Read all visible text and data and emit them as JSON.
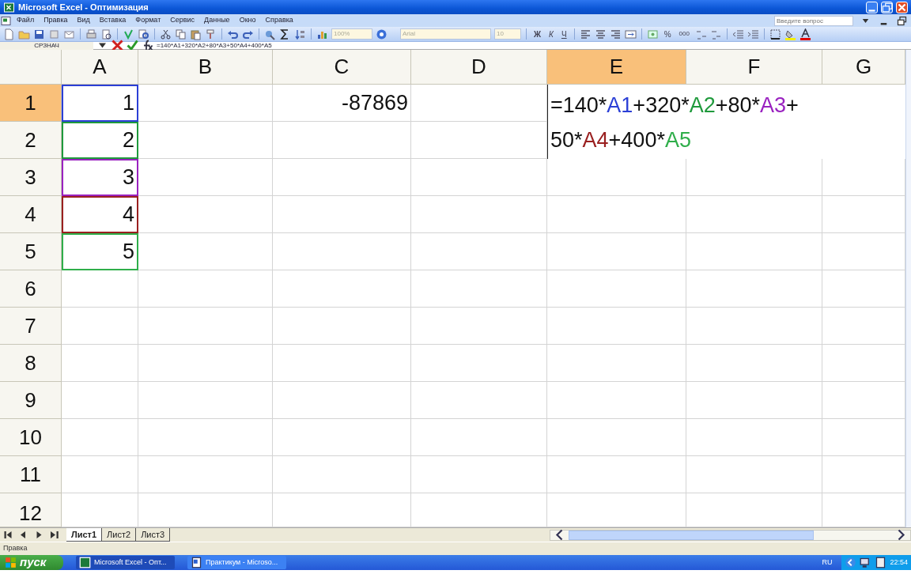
{
  "window": {
    "title": "Microsoft Excel - Оптимизация"
  },
  "menu": [
    "Файл",
    "Правка",
    "Вид",
    "Вставка",
    "Формат",
    "Сервис",
    "Данные",
    "Окно",
    "Справка"
  ],
  "help_box": {
    "placeholder": "Введите вопрос"
  },
  "toolbar": {
    "zoom": "100%",
    "font": "Arial",
    "font_size": "10",
    "bold": "Ж",
    "italic": "К",
    "underline": "Ч",
    "percent": "%",
    "thousands": "000"
  },
  "formula_bar": {
    "name_box": "СРЗНАЧ",
    "formula": "=140*A1+320*A2+80*A3+50*A4+400*A5"
  },
  "table": {
    "columns": [
      {
        "label": "A",
        "selected": false
      },
      {
        "label": "B",
        "selected": false
      },
      {
        "label": "C",
        "selected": false
      },
      {
        "label": "D",
        "selected": false
      },
      {
        "label": "E",
        "selected": true
      },
      {
        "label": "F",
        "selected": false
      },
      {
        "label": "G",
        "selected": false
      }
    ],
    "rows": [
      {
        "label": "1",
        "selected": true,
        "cells": [
          {
            "text": "1",
            "color": "#2b3fd6"
          },
          null,
          {
            "text": "-87869"
          }
        ]
      },
      {
        "label": "2",
        "selected": false,
        "cells": [
          {
            "text": "2",
            "color": "#1f9a3c"
          }
        ]
      },
      {
        "label": "3",
        "selected": false,
        "cells": [
          {
            "text": "3",
            "color": "#9a22c0"
          }
        ]
      },
      {
        "label": "4",
        "selected": false,
        "cells": [
          {
            "text": "4",
            "color": "#9a2020"
          }
        ]
      },
      {
        "label": "5",
        "selected": false,
        "cells": [
          {
            "text": "5",
            "color": "#2fae4a"
          }
        ]
      },
      {
        "label": "6",
        "selected": false,
        "cells": []
      },
      {
        "label": "7",
        "selected": false,
        "cells": []
      },
      {
        "label": "8",
        "selected": false,
        "cells": []
      },
      {
        "label": "9",
        "selected": false,
        "cells": []
      },
      {
        "label": "10",
        "selected": false,
        "cells": []
      },
      {
        "label": "11",
        "selected": false,
        "cells": []
      },
      {
        "label": "12",
        "selected": false,
        "cells": []
      }
    ]
  },
  "cell_editor": {
    "lines": [
      [
        {
          "text": "=140*"
        },
        {
          "text": "A1",
          "color": "#2b3fd6"
        },
        {
          "text": "+320*"
        },
        {
          "text": "A2",
          "color": "#1f9a3c"
        },
        {
          "text": "+80*"
        },
        {
          "text": "A3",
          "color": "#9a22c0"
        },
        {
          "text": "+"
        }
      ],
      [
        {
          "text": "50*"
        },
        {
          "text": "A4",
          "color": "#9a2020"
        },
        {
          "text": "+400*"
        },
        {
          "text": "A5",
          "color": "#2fae4a"
        }
      ]
    ]
  },
  "sheet_tabs": [
    {
      "label": "Лист1",
      "selected": true
    },
    {
      "label": "Лист2",
      "selected": false
    },
    {
      "label": "Лист3",
      "selected": false
    }
  ],
  "status_bar": {
    "text": "Правка"
  },
  "taskbar": {
    "start": "пуск",
    "tasks": [
      {
        "label": "Microsoft Excel - Опт...",
        "selected": true
      },
      {
        "label": "Практикум - Microso...",
        "selected": false
      }
    ],
    "language": "RU",
    "time": "22:54"
  }
}
